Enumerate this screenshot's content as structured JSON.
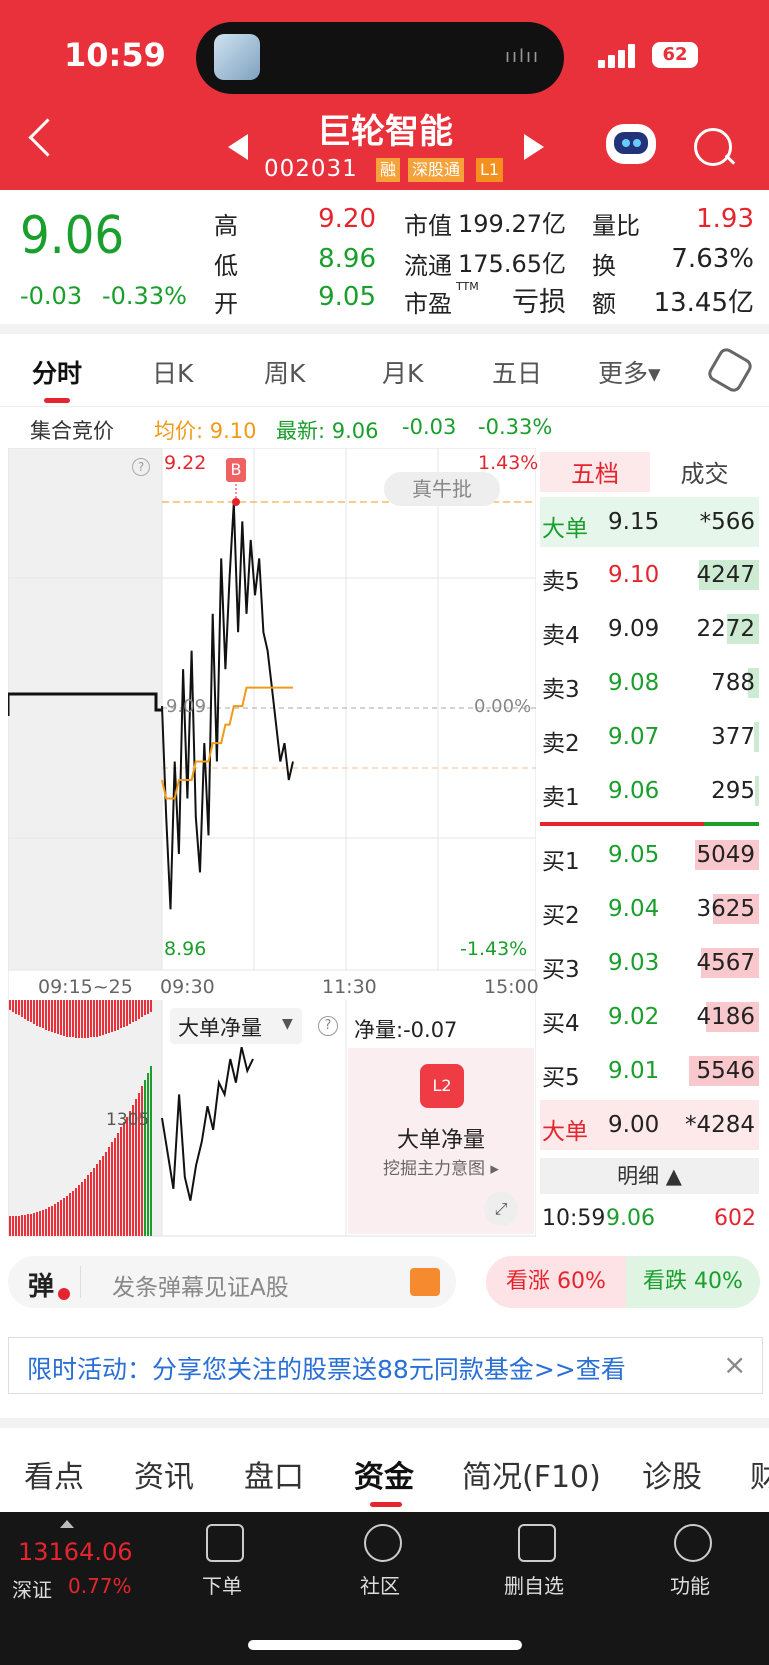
{
  "status_bar": {
    "time": "10:59",
    "battery": "62"
  },
  "header": {
    "stock_name": "巨轮智能",
    "stock_code": "002031",
    "tags": [
      "融",
      "深股通",
      "L1"
    ]
  },
  "quote": {
    "price": "9.06",
    "change": "-0.03",
    "change_pct": "-0.33%",
    "high_label": "高",
    "high": "9.20",
    "low_label": "低",
    "low": "8.96",
    "open_label": "开",
    "open": "9.05",
    "mcap_label": "市值",
    "mcap": "199.27亿",
    "float_label": "流通",
    "float": "175.65亿",
    "pe_label": "市盈",
    "pe_sup": "TTM",
    "pe": "亏损",
    "vr_label": "量比",
    "vr": "1.93",
    "turn_label": "换",
    "turn": "7.63%",
    "amt_label": "额",
    "amt": "13.45亿"
  },
  "period_tabs": [
    "分时",
    "日K",
    "周K",
    "月K",
    "五日",
    "更多▾"
  ],
  "chart_info": {
    "auction_label": "集合竞价",
    "avg": "均价: 9.10",
    "latest": "最新: 9.06",
    "chg": "-0.03",
    "chg_pct": "-0.33%"
  },
  "chart_data": {
    "type": "line",
    "title": "",
    "y_top": "9.22",
    "y_mid": "9.09",
    "y_bottom": "8.96",
    "pct_top": "1.43%",
    "pct_mid": "0.00%",
    "pct_bottom": "-1.43%",
    "x_ticks": [
      "09:15~25",
      "09:30",
      "11:30",
      "15:00"
    ],
    "ylim": [
      8.96,
      9.22
    ],
    "buy_marker": "B",
    "badge": "真牛批",
    "series": [
      {
        "values": [
          9.09,
          9.03,
          8.98,
          9.06,
          9.01,
          9.11,
          9.04,
          9.12,
          9.03,
          9.0,
          9.07,
          9.02,
          9.14,
          9.06,
          9.17,
          9.11,
          9.16,
          9.2,
          9.13,
          9.19,
          9.14,
          9.18,
          9.15,
          9.17,
          9.13,
          9.12,
          9.1,
          9.08,
          9.06,
          9.07,
          9.05,
          9.06
        ]
      },
      {
        "values": [
          9.05,
          9.04,
          9.04,
          9.04,
          9.05,
          9.05,
          9.05,
          9.05,
          9.06,
          9.06,
          9.06,
          9.06,
          9.07,
          9.07,
          9.07,
          9.08,
          9.08,
          9.09,
          9.09,
          9.09,
          9.1,
          9.1,
          9.1,
          9.1,
          9.1,
          9.1,
          9.1,
          9.1,
          9.1,
          9.1,
          9.1,
          9.1
        ]
      }
    ],
    "net_label": "大单净量",
    "net_value": "净量:-0.07",
    "net_axis": "1305",
    "net_series": [
      0.0,
      -0.3,
      -0.6,
      0.2,
      -0.5,
      -0.7,
      -0.4,
      -0.2,
      0.1,
      -0.1,
      0.3,
      0.2,
      0.5,
      0.3,
      0.6,
      0.4,
      0.5
    ]
  },
  "l2_panel": {
    "title": "大单净量",
    "subtitle": "挖掘主力意图 ▸"
  },
  "depth": {
    "tabs": [
      "五档",
      "成交"
    ],
    "big_sell": {
      "label": "大单",
      "price": "9.15",
      "vol": "*566"
    },
    "sells": [
      {
        "label": "卖5",
        "price": "9.10",
        "vol": "4247"
      },
      {
        "label": "卖4",
        "price": "9.09",
        "vol": "2272"
      },
      {
        "label": "卖3",
        "price": "9.08",
        "vol": "788"
      },
      {
        "label": "卖2",
        "price": "9.07",
        "vol": "377"
      },
      {
        "label": "卖1",
        "price": "9.06",
        "vol": "295"
      }
    ],
    "buys": [
      {
        "label": "买1",
        "price": "9.05",
        "vol": "5049"
      },
      {
        "label": "买2",
        "price": "9.04",
        "vol": "3625"
      },
      {
        "label": "买3",
        "price": "9.03",
        "vol": "4567"
      },
      {
        "label": "买4",
        "price": "9.02",
        "vol": "4186"
      },
      {
        "label": "买5",
        "price": "9.01",
        "vol": "5546"
      }
    ],
    "big_buy": {
      "label": "大单",
      "price": "9.00",
      "vol": "*4284"
    },
    "detail_label": "明细 ▲",
    "trade": {
      "time": "10:59",
      "price": "9.06",
      "vol": "602"
    }
  },
  "danmu": {
    "icon": "弹",
    "placeholder": "发条弹幕见证A股"
  },
  "sentiment": {
    "up": "看涨 60%",
    "down": "看跌 40%"
  },
  "promo": {
    "text": "限时活动：分享您关注的股票送88元同款基金>>查看",
    "close": "×"
  },
  "bottom_tabs": [
    "看点",
    "资讯",
    "盘口",
    "资金",
    "简况(F10)",
    "诊股",
    "财"
  ],
  "tabbar": {
    "index_value": "13164.06",
    "index_name": "深证",
    "index_pct": "0.77%",
    "items": [
      "下单",
      "社区",
      "删自选",
      "功能"
    ]
  },
  "colors": {
    "header": "#e8313a",
    "up": "#e5252e",
    "down": "#1a9e2c",
    "link": "#2a6fd6"
  }
}
